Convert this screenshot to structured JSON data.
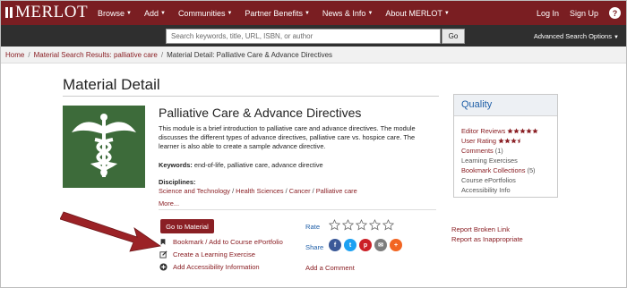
{
  "header": {
    "logo": "MERLOT",
    "nav": [
      {
        "label": "Browse"
      },
      {
        "label": "Add"
      },
      {
        "label": "Communities"
      },
      {
        "label": "Partner Benefits"
      },
      {
        "label": "News & Info"
      },
      {
        "label": "About MERLOT"
      }
    ],
    "login": "Log In",
    "signup": "Sign Up",
    "help": "?",
    "accent_color": "#7a1e22"
  },
  "search": {
    "placeholder": "Search keywords, title, URL, ISBN, or author",
    "go_label": "Go",
    "advanced_label": "Advanced Search Options"
  },
  "breadcrumb": {
    "home": "Home",
    "results": "Material Search Results: palliative care",
    "current": "Material Detail: Palliative Care & Advance Directives",
    "sep": "/"
  },
  "page": {
    "title": "Material Detail"
  },
  "material": {
    "title": "Palliative Care & Advance Directives",
    "description": "This module is a brief introduction to palliative care and advance directives. The module discusses the different types of advance directives, palliative care vs. hospice care. The learner is also able to create a sample advance directive.",
    "keywords_label": "Keywords:",
    "keywords": "end-of-life, palliative care, advance directive",
    "disciplines_label": "Disciplines:",
    "disciplines": [
      "Science and Technology",
      "Health Sciences",
      "Cancer",
      "Palliative care"
    ],
    "more_label": "More...",
    "thumbnail_icon": "caduceus-icon"
  },
  "actions": {
    "go_to_material": "Go to Material",
    "bookmark": "Bookmark / Add to Course ePortfolio",
    "create_exercise": "Create a Learning Exercise",
    "accessibility": "Add Accessibility Information"
  },
  "social": {
    "rate_label": "Rate",
    "share_label": "Share",
    "add_comment": "Add a Comment",
    "share_icons": [
      {
        "name": "facebook-icon",
        "glyph": "f",
        "color": "#3b5998"
      },
      {
        "name": "twitter-icon",
        "glyph": "t",
        "color": "#1da1f2"
      },
      {
        "name": "pinterest-icon",
        "glyph": "p",
        "color": "#cb2027"
      },
      {
        "name": "email-icon",
        "glyph": "✉",
        "color": "#7d7d7d"
      },
      {
        "name": "more-share-icon",
        "glyph": "+",
        "color": "#f26522"
      }
    ]
  },
  "quality": {
    "heading": "Quality",
    "editor_reviews": "Editor Reviews",
    "editor_rating": 5,
    "user_rating_label": "User Rating",
    "user_rating": 3.5,
    "comments_label": "Comments",
    "comments_count": "(1)",
    "learning_exercises": "Learning Exercises",
    "bookmark_collections": "Bookmark Collections",
    "bookmark_count": "(5)",
    "course_eportfolios": "Course ePortfolios",
    "accessibility_info": "Accessibility Info"
  },
  "report": {
    "broken_link": "Report Broken Link",
    "inappropriate": "Report as Inappropriate"
  }
}
